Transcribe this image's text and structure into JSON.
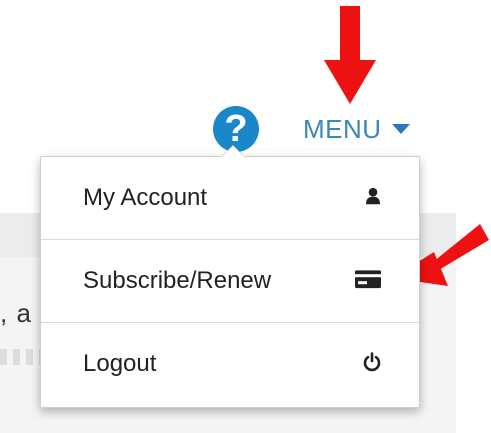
{
  "header": {
    "help_icon": "question-circle-icon",
    "help_glyph": "?",
    "menu_label": "MENU",
    "menu_caret_icon": "caret-down-icon"
  },
  "dropdown": {
    "items": [
      {
        "label": "My Account",
        "icon": "user-icon"
      },
      {
        "label": "Subscribe/Renew",
        "icon": "credit-card-icon"
      },
      {
        "label": "Logout",
        "icon": "power-icon"
      }
    ]
  },
  "background": {
    "partial_text": ", a"
  },
  "annotations": {
    "arrow_color": "#ee1111",
    "arrows": [
      "arrow-down-annotation",
      "arrow-left-annotation"
    ]
  },
  "colors": {
    "accent": "#1a87c8",
    "menu_text": "#3c86b8",
    "arrow": "#ee1111"
  }
}
